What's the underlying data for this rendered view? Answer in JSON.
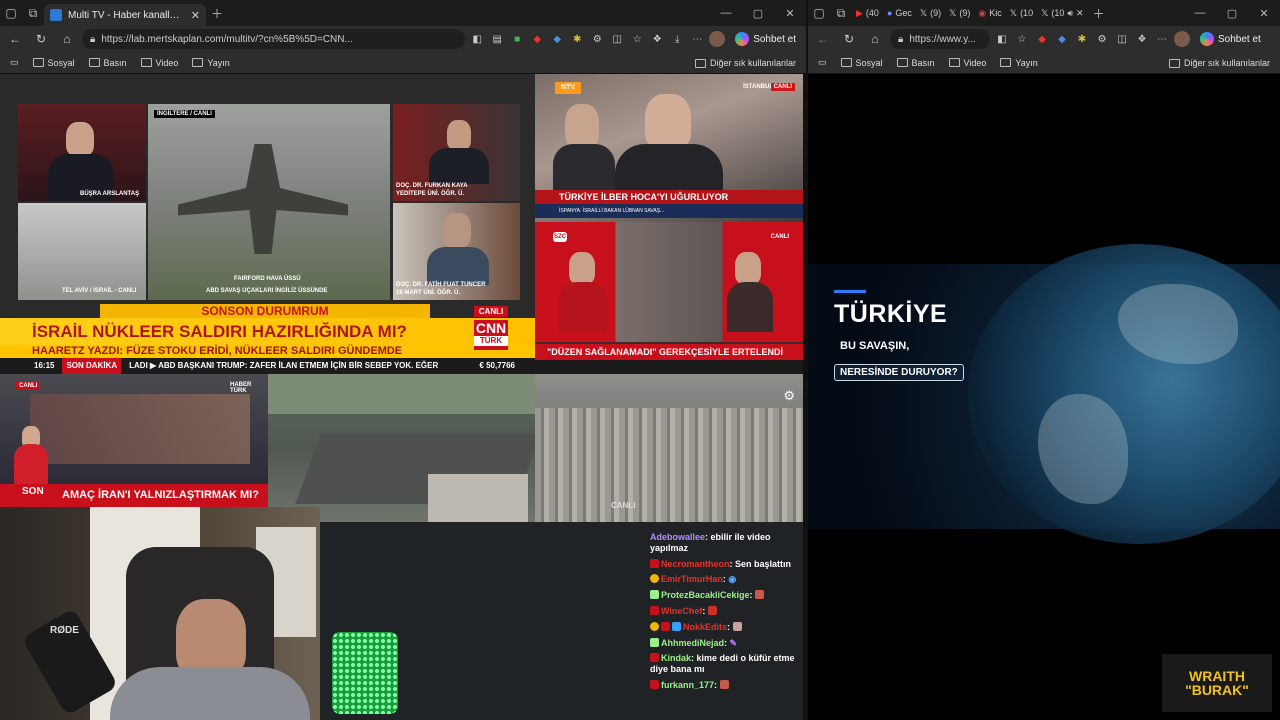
{
  "left_window": {
    "tab": {
      "title": "Multi TV - Haber kanallarını aynı a"
    },
    "url": "https://lab.mertskaplan.com/multitv/?cn%5B%5D=CNN...",
    "sohbet": "Sohbet et",
    "bookmarks": [
      "Sosyal",
      "Basın",
      "Video",
      "Yayın"
    ],
    "other_favorites": "Diğer sık kullanılanlar"
  },
  "right_window": {
    "tabs": [
      "(40",
      "Gec",
      "(9)",
      "(9)",
      "Kic",
      "(10",
      "(10"
    ],
    "url": "https://www.y...",
    "sohbet": "Sohbet et",
    "bookmarks": [
      "Sosyal",
      "Basın",
      "Video",
      "Yayın"
    ],
    "other_favorites": "Diğer sık kullanılanlar"
  },
  "cnn": {
    "tag_top": "İNGİLTERE / CANLI",
    "name1": "BÜŞRA ARSLANTAŞ",
    "guest1": "DOÇ. DR. FURKAN KAYA",
    "guest1_sub": "YEDİTEPE ÜNİ. ÖĞR. Ü.",
    "guest2": "DOÇ. DR. FATİH FUAT TUNCER",
    "guest2_sub": "18 MART ÜNİ. ÖĞR. Ü.",
    "tel_aviv": "TEL AVİV / İSRAİL - CANLI",
    "fairford": "FAIRFORD HAVA ÜSSÜ",
    "fairford_sub": "ABD SAVAŞ UÇAKLARI İNGİLİZ ÜSSÜNDE",
    "banner_top": "SONSON DURUMRUM",
    "headline": "İSRAİL NÜKLEER SALDIRI HAZIRLIĞINDA MI?",
    "subheadline": "HAARETZ YAZDI: FÜZE STOKU ERİDİ, NÜKLEER SALDIRI GÜNDEMDE",
    "live": "CANLI",
    "logo1": "CNN",
    "logo2": "TÜRK",
    "time": "16:15",
    "son_dakika": "SON DAKİKA",
    "ticker": "LADI  ▶ ABD BAŞKANI TRUMP: ZAFER İLAN ETMEM İÇİN BİR SEBEP YOK. EĞER",
    "index": "€ 50,7766"
  },
  "ntv": {
    "location": "İSTANBUL",
    "live": "CANLI",
    "headline": "TÜRKİYE İLBER HOCA'YI UĞURLUYOR",
    "ticker": "İSPANYA: İSRAİLLİ BAKAN LÜBNAN SAVAŞ..."
  },
  "szc": {
    "logo": "SZC",
    "live": "CANLI",
    "headline": "\"DÜZEN SAĞLANAMADI\" GEREKÇESİYLE ERTELENDİ"
  },
  "haberturk": {
    "logo": "HABER TÜRK",
    "live": "CANLI",
    "son": "SON",
    "durum": "durum",
    "headline": "AMAÇ İRAN'I YALNIZLAŞTIRMAK MI?"
  },
  "beirut": {
    "live": "CANLI"
  },
  "webcam": {
    "mic_brand": "RØDE"
  },
  "chat": [
    {
      "user": "Adebowallee",
      "color": "#b48cff",
      "msg": "ebilir ile video yapılmaz"
    },
    {
      "user": "Necromantheon",
      "color": "#e5312a",
      "msg": "Sen başlattın"
    },
    {
      "user": "EmirTimurHan",
      "color": "#e5312a",
      "msg": ""
    },
    {
      "user": "ProtezBacakliCekige",
      "color": "#9cf08a",
      "msg": ""
    },
    {
      "user": "WineChef",
      "color": "#e5312a",
      "msg": ""
    },
    {
      "user": "NokkEdits",
      "color": "#e5312a",
      "msg": ""
    },
    {
      "user": "AhhmediNejad",
      "color": "#9cf08a",
      "msg": ""
    },
    {
      "user": "Kindak",
      "color": "#9cf08a",
      "msg": "kime dedi o küfür etme diye bana mı"
    },
    {
      "user": "furkann_177",
      "color": "#9cf08a",
      "msg": ""
    }
  ],
  "promo": {
    "title": "TÜRKİYE",
    "line2": "BU SAVAŞIN,",
    "line3": "NERESİNDE DURUYOR?"
  },
  "brand": {
    "line1": "WRAITH",
    "line2": "\"BURAK\""
  }
}
